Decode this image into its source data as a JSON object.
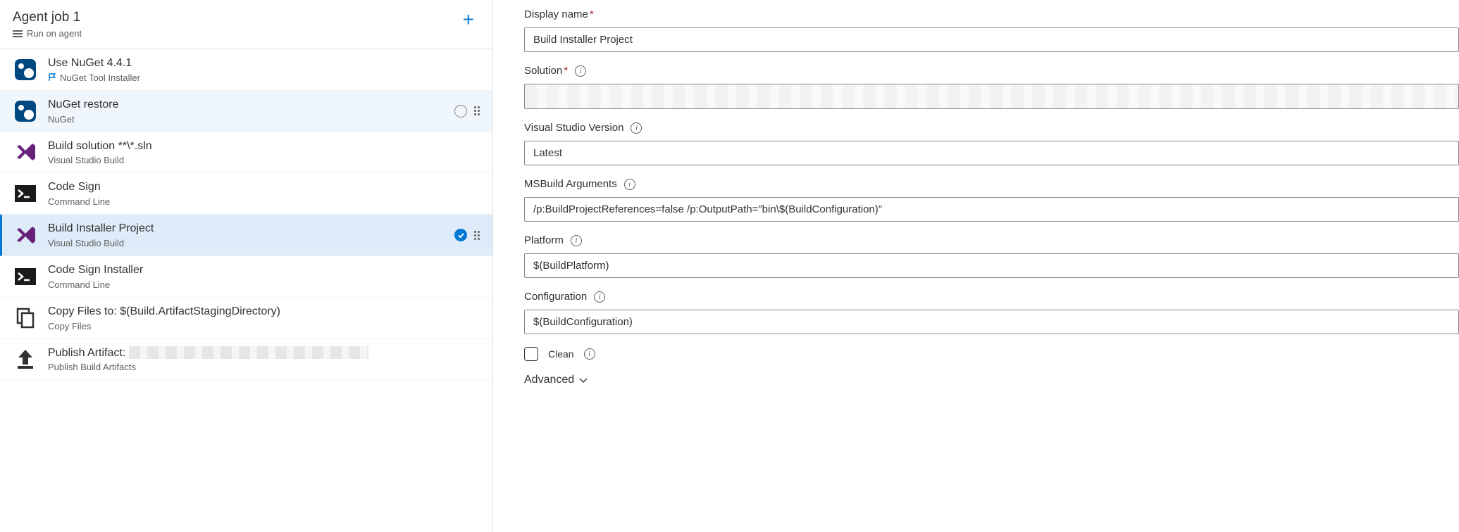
{
  "job": {
    "title": "Agent job 1",
    "subtitle": "Run on agent"
  },
  "tasks": [
    {
      "title": "Use NuGet 4.4.1",
      "sub": "NuGet Tool Installer",
      "icon": "nuget",
      "hasFlag": true
    },
    {
      "title": "NuGet restore",
      "sub": "NuGet",
      "icon": "nuget",
      "state": "hover"
    },
    {
      "title": "Build solution **\\*.sln",
      "sub": "Visual Studio Build",
      "icon": "vs"
    },
    {
      "title": "Code Sign",
      "sub": "Command Line",
      "icon": "cmd"
    },
    {
      "title": "Build Installer Project",
      "sub": "Visual Studio Build",
      "icon": "vs",
      "state": "selected"
    },
    {
      "title": "Code Sign Installer",
      "sub": "Command Line",
      "icon": "cmd"
    },
    {
      "title": "Copy Files to: $(Build.ArtifactStagingDirectory)",
      "sub": "Copy Files",
      "icon": "copy"
    },
    {
      "title": "Publish Artifact:",
      "sub": "Publish Build Artifacts",
      "icon": "publish",
      "titleBlurred": true
    }
  ],
  "form": {
    "displayName": {
      "label": "Display name",
      "required": true,
      "value": "Build Installer Project"
    },
    "solution": {
      "label": "Solution",
      "required": true,
      "value": "",
      "blurred": true
    },
    "vsVersion": {
      "label": "Visual Studio Version",
      "value": "Latest"
    },
    "msbuild": {
      "label": "MSBuild Arguments",
      "value": "/p:BuildProjectReferences=false /p:OutputPath=\"bin\\$(BuildConfiguration)\""
    },
    "platform": {
      "label": "Platform",
      "value": "$(BuildPlatform)"
    },
    "configuration": {
      "label": "Configuration",
      "value": "$(BuildConfiguration)"
    },
    "clean": {
      "label": "Clean",
      "checked": false
    },
    "advanced": {
      "label": "Advanced"
    }
  }
}
